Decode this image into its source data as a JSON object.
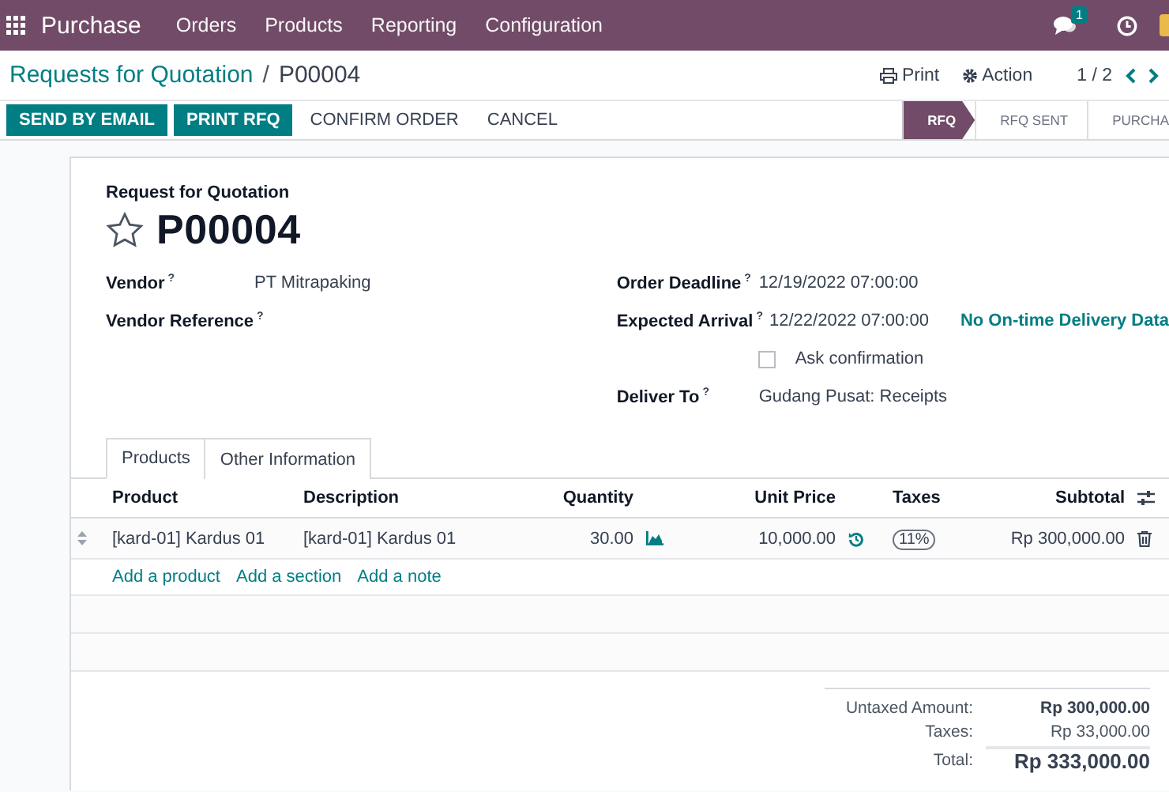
{
  "navbar": {
    "app": "Purchase",
    "menus": [
      "Orders",
      "Products",
      "Reporting",
      "Configuration"
    ],
    "chat_count": "1"
  },
  "control_panel": {
    "breadcrumb": {
      "parent": "Requests for Quotation",
      "separator": "/",
      "current": "P00004"
    },
    "print": "Print",
    "action": "Action",
    "pager": "1 / 2"
  },
  "buttons": [
    {
      "label": "SEND BY EMAIL",
      "kind": "primary"
    },
    {
      "label": "PRINT RFQ",
      "kind": "primary"
    },
    {
      "label": "CONFIRM ORDER",
      "kind": "secondary"
    },
    {
      "label": "CANCEL",
      "kind": "secondary"
    }
  ],
  "status_steps": [
    {
      "label": "RFQ",
      "selected": true
    },
    {
      "label": "RFQ SENT",
      "selected": false
    },
    {
      "label": "PURCHA",
      "selected": false
    }
  ],
  "form": {
    "subtitle": "Request for Quotation",
    "name": "P00004",
    "starred": false,
    "left_fields": [
      {
        "label": "Vendor",
        "help": "?",
        "value": "PT Mitrapaking"
      },
      {
        "label": "Vendor Reference",
        "help": "?"
      }
    ],
    "right_fields": [
      {
        "kind": "field",
        "label": "Order Deadline",
        "help": "?",
        "value": "12/19/2022 07:00:00"
      },
      {
        "kind": "field",
        "label": "Expected Arrival",
        "help": "?",
        "value": "12/22/2022 07:00:00",
        "extra": "No On-time Delivery Data"
      },
      {
        "kind": "checkbox",
        "label": "Ask confirmation",
        "checked": false
      },
      {
        "kind": "field",
        "label": "Deliver To",
        "help": "?",
        "value": "Gudang Pusat: Receipts"
      }
    ],
    "tabs": [
      {
        "label": "Products",
        "selected": true
      },
      {
        "label": "Other Information",
        "selected": false
      }
    ],
    "table": {
      "columns": [
        "Product",
        "Description",
        "Quantity",
        "Unit Price",
        "Taxes",
        "Subtotal"
      ],
      "rows": [
        {
          "product": "[kard-01] Kardus 01",
          "description": "[kard-01] Kardus 01",
          "quantity": "30.00",
          "unit_price": "10,000.00",
          "taxes": "11%",
          "subtotal": "Rp 300,000.00"
        }
      ],
      "add_links": [
        "Add a product",
        "Add a section",
        "Add a note"
      ]
    },
    "totals": [
      {
        "label": "Untaxed Amount:",
        "value": "Rp 300,000.00",
        "kind": "bold"
      },
      {
        "label": "Taxes:",
        "value": "Rp 33,000.00",
        "kind": "plain"
      },
      {
        "label": "Total:",
        "value": "Rp 333,000.00",
        "kind": "grand"
      }
    ]
  }
}
